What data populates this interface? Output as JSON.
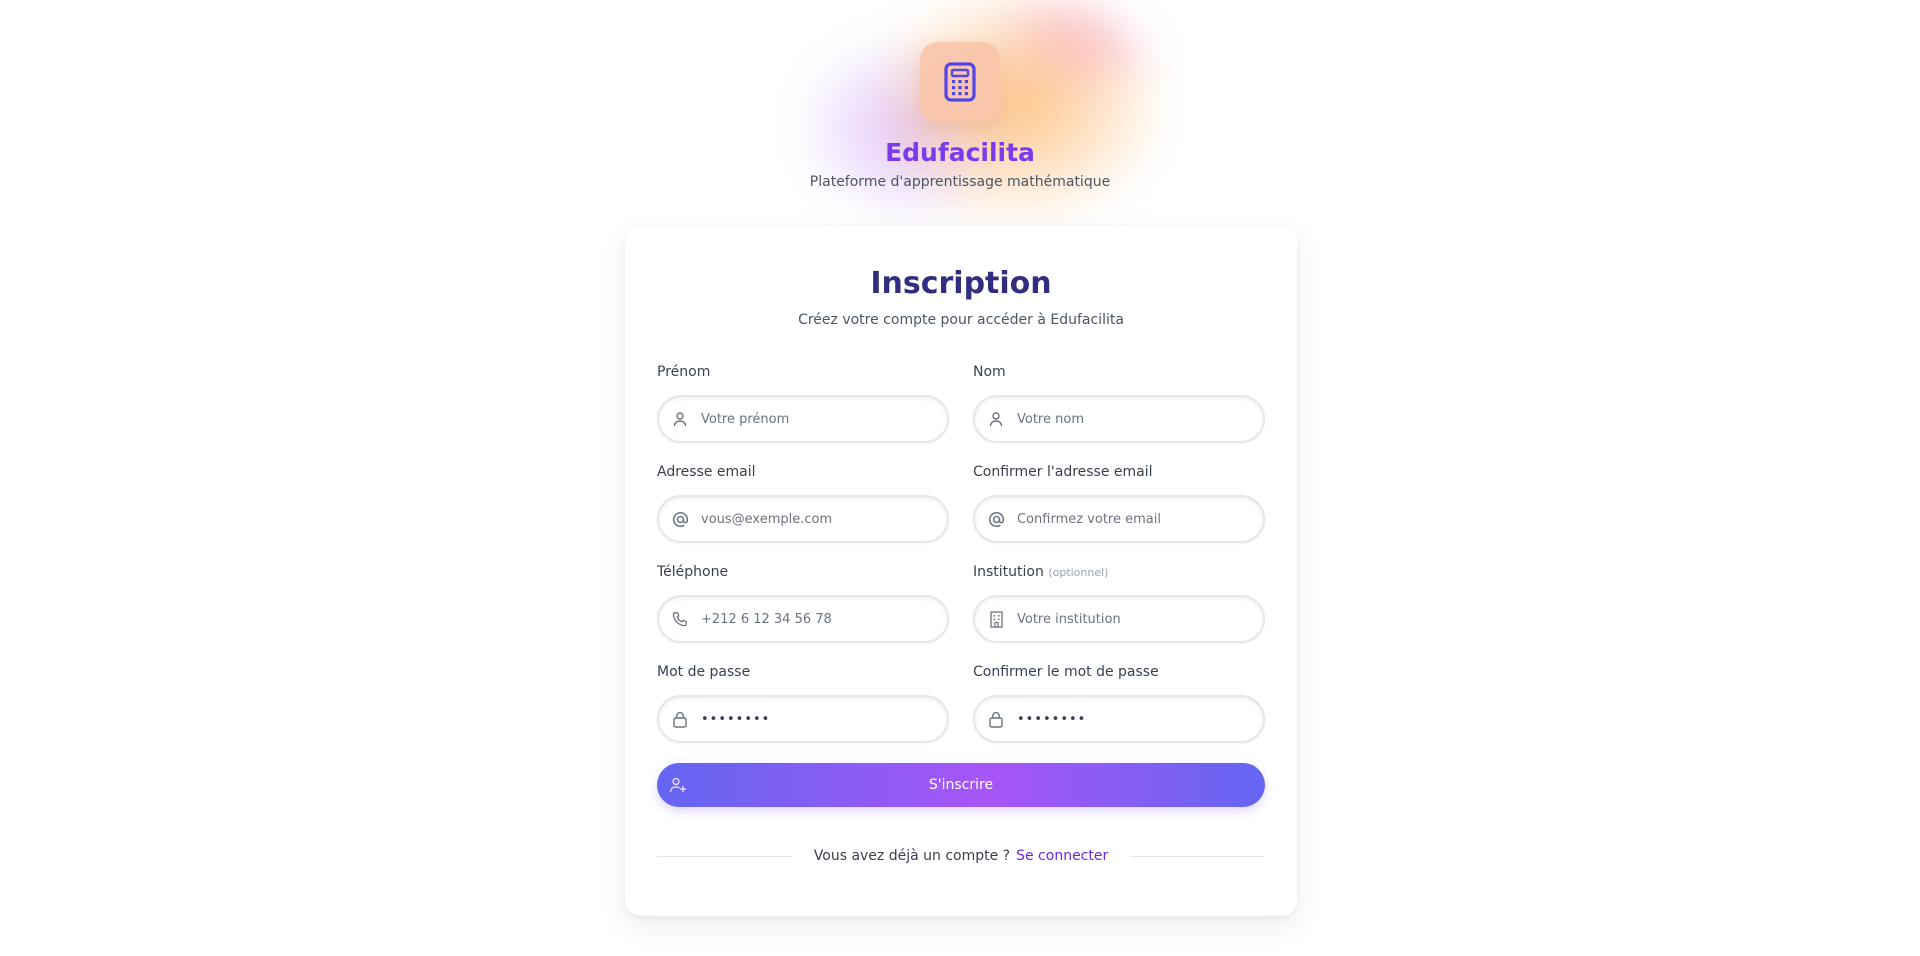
{
  "brand": {
    "name": "Edufacilita",
    "tagline": "Plateforme d'apprentissage mathématique",
    "icon": "calculator-icon",
    "accent_color": "#7c3aed"
  },
  "card": {
    "title": "Inscription",
    "subtitle": "Créez votre compte pour accéder à Edufacilita"
  },
  "form": {
    "first_name": {
      "label": "Prénom",
      "placeholder": "Votre prénom",
      "icon": "user-icon"
    },
    "last_name": {
      "label": "Nom",
      "placeholder": "Votre nom",
      "icon": "user-icon"
    },
    "email": {
      "label": "Adresse email",
      "placeholder": "vous@exemple.com",
      "icon": "at-icon"
    },
    "email_confirm": {
      "label": "Confirmer l'adresse email",
      "placeholder": "Confirmez votre email",
      "icon": "at-icon"
    },
    "phone": {
      "label": "Téléphone",
      "placeholder": "+212 6 12 34 56 78",
      "icon": "phone-icon"
    },
    "institution": {
      "label": "Institution",
      "optional": "(optionnel)",
      "placeholder": "Votre institution",
      "icon": "building-icon"
    },
    "password": {
      "label": "Mot de passe",
      "value": "••••••••",
      "icon": "lock-icon"
    },
    "password_confirm": {
      "label": "Confirmer le mot de passe",
      "value": "••••••••",
      "icon": "lock-icon"
    }
  },
  "submit": {
    "label": "S'inscrire",
    "icon": "user-plus-icon"
  },
  "footer": {
    "question": "Vous avez déjà un compte ?",
    "login_link": "Se connecter"
  }
}
